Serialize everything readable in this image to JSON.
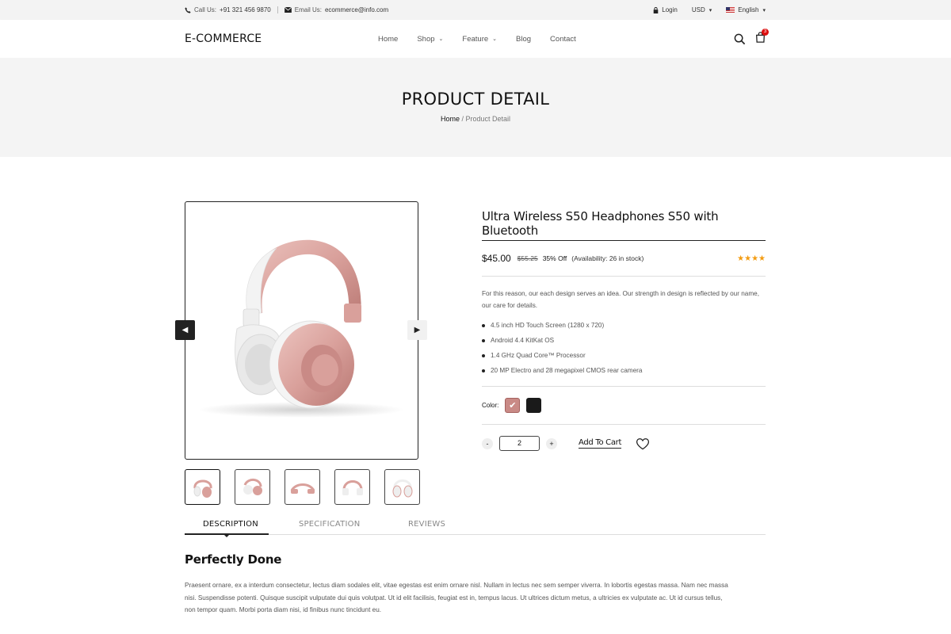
{
  "topbar": {
    "phone_label": "Call Us:",
    "phone": "+91 321 456 9870",
    "email_label": "Email Us:",
    "email": "ecommerce@info.com",
    "login": "Login",
    "currency": "USD",
    "language": "English"
  },
  "nav": {
    "logo": "E-COMMERCE",
    "items": [
      {
        "label": "Home"
      },
      {
        "label": "Shop"
      },
      {
        "label": "Feature"
      },
      {
        "label": "Blog"
      },
      {
        "label": "Contact"
      }
    ],
    "cart_count": "3"
  },
  "hero": {
    "title": "PRODUCT DETAIL",
    "crumb_home": "Home",
    "crumb_sep": "/",
    "crumb_current": "Product Detail"
  },
  "product": {
    "title": "Ultra Wireless S50 Headphones S50 with Bluetooth",
    "price": "$45.00",
    "old_price": "$55.25",
    "discount": "35% Off",
    "availability": "(Availability: 26 in stock)",
    "rating_stars": 4,
    "description": "For this reason, our each design serves an idea. Our strength in design is reflected by our name, our care for details.",
    "features": [
      "4.5 inch HD Touch Screen (1280 x 720)",
      "Android 4.4 KitKat OS",
      "1.4 GHz Quad Core™ Processor",
      "20 MP Electro and 28 megapixel CMOS rear camera"
    ],
    "color_label": "Color:",
    "colors": [
      "#c98a86",
      "#1a1a1a"
    ],
    "quantity": "2",
    "minus": "-",
    "plus": "+",
    "add_to_cart": "Add To Cart",
    "thumbnail_count": 5
  },
  "tabs": {
    "items": [
      "DESCRIPTION",
      "SPECIFICATION",
      "REVIEWS"
    ],
    "active": "DESCRIPTION"
  },
  "description": {
    "heading": "Perfectly Done",
    "body": "Praesent ornare, ex a interdum consectetur, lectus diam sodales elit, vitae egestas est enim ornare nisl. Nullam in lectus nec sem semper viverra. In lobortis egestas massa. Nam nec massa nisi. Suspendisse potenti. Quisque suscipit vulputate dui quis volutpat. Ut id elit facilisis, feugiat est in, tempus lacus. Ut ultrices dictum metus, a ultricies ex vulputate ac. Ut id cursus tellus, non tempor quam. Morbi porta diam nisi, id finibus nunc tincidunt eu."
  },
  "colors": {
    "accent": "#222222",
    "star": "#f39c12",
    "badge": "#dd1111",
    "headphone_pink": "#d9a09b"
  }
}
